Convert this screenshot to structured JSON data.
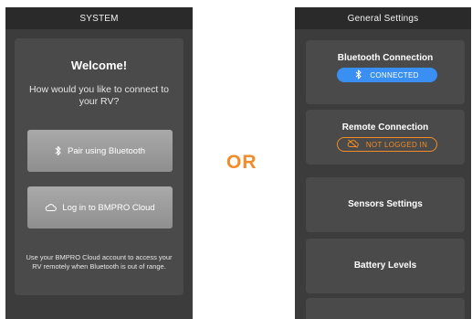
{
  "left_screen": {
    "title": "SYSTEM",
    "welcome_title": "Welcome!",
    "question": "How would you like to connect to your RV?",
    "bluetooth_button": "Pair using Bluetooth",
    "cloud_button": "Log in to BMPRO Cloud",
    "footnote": "Use your BMPRO Cloud account to access your RV remotely when Bluetooth is out of range."
  },
  "separator": {
    "text": "OR"
  },
  "right_screen": {
    "title": "General Settings",
    "bluetooth_card": {
      "title": "Bluetooth Connection",
      "status": "CONNECTED"
    },
    "remote_card": {
      "title": "Remote Connection",
      "status": "NOT LOGGED IN"
    },
    "sensors_card": {
      "title": "Sensors Settings"
    },
    "battery_card": {
      "title": "Battery Levels"
    }
  },
  "colors": {
    "accent_orange": "#f28c28",
    "connected_blue": "#3a8ff2",
    "panel_dark": "#3c3c3c",
    "card_gray": "#4a4a4a",
    "button_gray": "#9e9e9e"
  },
  "icons": [
    "bluetooth-icon",
    "cloud-icon",
    "cloud-off-icon"
  ]
}
